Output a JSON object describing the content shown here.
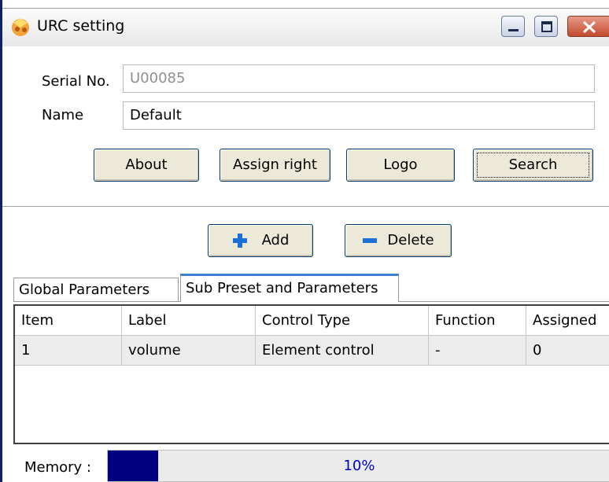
{
  "window": {
    "title": "URC setting"
  },
  "form": {
    "serial_label": "Serial No.",
    "serial_value": "U00085",
    "name_label": "Name",
    "name_value": "Default"
  },
  "buttons": {
    "about": "About",
    "assign_right": "Assign right",
    "logo": "Logo",
    "search": "Search",
    "add": "Add",
    "delete": "Delete"
  },
  "icons": {
    "add": "plus-icon",
    "delete": "minus-icon",
    "app": "app-icon"
  },
  "tabs": [
    {
      "label": "Global Parameters",
      "active": false
    },
    {
      "label": "Sub Preset and Parameters",
      "active": true
    }
  ],
  "table": {
    "columns": [
      "Item",
      "Label",
      "Control Type",
      "Function",
      "Assigned"
    ],
    "rows": [
      [
        "1",
        "volume",
        "Element control",
        "-",
        "0"
      ]
    ]
  },
  "memory": {
    "label": "Memory :",
    "percent_text": "10%",
    "value": 0.1
  },
  "colors": {
    "accent_blue": "#1a6fd8",
    "progress_fill": "#000080",
    "close_red": "#c24a2c"
  }
}
